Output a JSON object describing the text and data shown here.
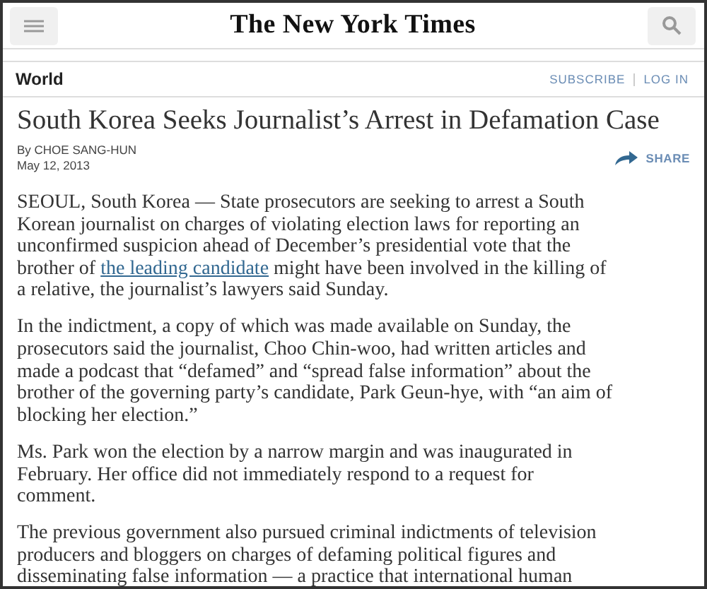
{
  "header": {
    "logo": "The New York Times"
  },
  "section_bar": {
    "section": "World",
    "links": [
      "SUBSCRIBE",
      "LOG IN"
    ]
  },
  "article": {
    "headline": "South Korea Seeks Journalist’s Arrest in Defamation Case",
    "byline": "By CHOE SANG-HUN",
    "date": "May 12, 2013",
    "share": "SHARE",
    "paragraphs": [
      {
        "segments": [
          {
            "kind": "text",
            "text": "SEOUL, South Korea — State prosecutors are seeking to arrest a South\nKorean journalist on charges of violating election laws for reporting an\nunconfirmed suspicion ahead of December’s presidential vote that the\nbrother of "
          },
          {
            "kind": "link",
            "text": "the leading candidate"
          },
          {
            "kind": "text",
            "text": " might have been involved in the killing of\na relative, the journalist’s lawyers said Sunday."
          }
        ]
      },
      {
        "segments": [
          {
            "kind": "text",
            "text": "In the indictment, a copy of which was made available on Sunday, the\nprosecutors said the journalist, Choo Chin-woo, had written articles and\nmade a podcast that “defamed” and “spread false information” about the\nbrother of the governing party’s candidate, Park Geun-hye, with “an aim of\nblocking her election.”"
          }
        ]
      },
      {
        "segments": [
          {
            "kind": "text",
            "text": "Ms. Park won the election by a narrow margin and was inaugurated in\nFebruary. Her office did not immediately respond to a request for\ncomment."
          }
        ]
      },
      {
        "segments": [
          {
            "kind": "text",
            "text": "The previous government also pursued criminal indictments of television\nproducers and bloggers on charges of defaming political figures and\ndisseminating false information — a practice that international human"
          }
        ]
      }
    ]
  }
}
